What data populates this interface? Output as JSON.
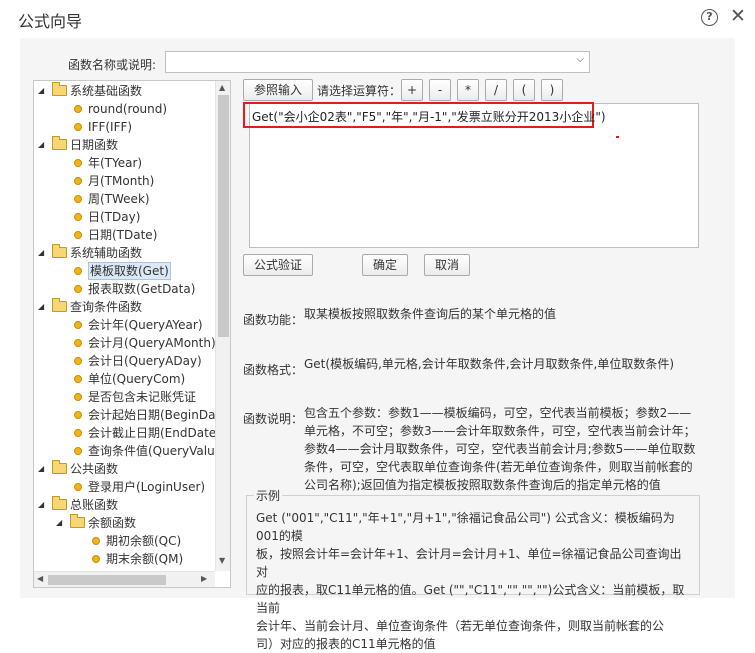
{
  "window": {
    "title": "公式向导"
  },
  "function_name": {
    "label": "函数名称或说明:",
    "value": ""
  },
  "tree": [
    {
      "level": 0,
      "type": "folder",
      "label": "系统基础函数",
      "expanded": true
    },
    {
      "level": 1,
      "type": "leaf",
      "label": "round(round)"
    },
    {
      "level": 1,
      "type": "leaf",
      "label": "IFF(IFF)"
    },
    {
      "level": 0,
      "type": "folder",
      "label": "日期函数",
      "expanded": true
    },
    {
      "level": 1,
      "type": "leaf",
      "label": "年(TYear)"
    },
    {
      "level": 1,
      "type": "leaf",
      "label": "月(TMonth)"
    },
    {
      "level": 1,
      "type": "leaf",
      "label": "周(TWeek)"
    },
    {
      "level": 1,
      "type": "leaf",
      "label": "日(TDay)"
    },
    {
      "level": 1,
      "type": "leaf",
      "label": "日期(TDate)"
    },
    {
      "level": 0,
      "type": "folder",
      "label": "系统辅助函数",
      "expanded": true
    },
    {
      "level": 1,
      "type": "leaf",
      "label": "模板取数(Get)",
      "selected": true
    },
    {
      "level": 1,
      "type": "leaf",
      "label": "报表取数(GetData)"
    },
    {
      "level": 0,
      "type": "folder",
      "label": "查询条件函数",
      "expanded": true
    },
    {
      "level": 1,
      "type": "leaf",
      "label": "会计年(QueryAYear)"
    },
    {
      "level": 1,
      "type": "leaf",
      "label": "会计月(QueryAMonth)"
    },
    {
      "level": 1,
      "type": "leaf",
      "label": "会计日(QueryADay)"
    },
    {
      "level": 1,
      "type": "leaf",
      "label": "单位(QueryCom)"
    },
    {
      "level": 1,
      "type": "leaf",
      "label": "是否包含未记账凭证"
    },
    {
      "level": 1,
      "type": "leaf",
      "label": "会计起始日期(BeginDate)"
    },
    {
      "level": 1,
      "type": "leaf",
      "label": "会计截止日期(EndDate)"
    },
    {
      "level": 1,
      "type": "leaf",
      "label": "查询条件值(QueryValue)"
    },
    {
      "level": 0,
      "type": "folder",
      "label": "公共函数",
      "expanded": true
    },
    {
      "level": 1,
      "type": "leaf",
      "label": "登录用户(LoginUser)"
    },
    {
      "level": 0,
      "type": "folder",
      "label": "总账函数",
      "expanded": true
    },
    {
      "level": 1,
      "type": "folder",
      "label": "余额函数",
      "expanded": true
    },
    {
      "level": 2,
      "type": "leaf",
      "label": "期初余额(QC)"
    },
    {
      "level": 2,
      "type": "leaf",
      "label": "期末余额(QM)"
    }
  ],
  "toolbar": {
    "ref_input": "参照输入",
    "operator_label": "请选择运算符：",
    "operators": [
      "+",
      "-",
      "*",
      "/",
      "(",
      ")"
    ]
  },
  "formula": {
    "value": "Get(\"会小企02表\",\"F5\",\"年\",\"月-1\",\"发票立账分开2013小企业\")"
  },
  "actions": {
    "verify": "公式验证",
    "ok": "确定",
    "cancel": "取消"
  },
  "info": {
    "function_label": "函数功能：",
    "function_text": "取某模板按照取数条件查询后的某个单元格的值",
    "format_label": "函数格式：",
    "format_text": "Get(模板编码,单元格,会计年取数条件,会计月取数条件,单位取数条件)",
    "desc_label": "函数说明：",
    "desc_lines": [
      "包含五个参数：参数1——模板编码，可空，空代表当前模板；参数2——",
      "单元格，不可空；参数3——会计年取数条件，可空，空代表当前会计年；",
      "参数4——会计月取数条件，可空，空代表当前会计月;参数5——单位取数",
      "条件，可空，空代表取单位查询条件(若无单位查询条件，则取当前帐套的",
      "公司名称);返回值为指定模板按照取数条件查询后的指定单元格的值"
    ]
  },
  "example": {
    "legend": "示例",
    "lines": [
      "Get (\"001\",\"C11\",\"年+1\",\"月+1\",\"徐福记食品公司\") 公式含义：模板编码为001的模",
      "板，按照会计年=会计年+1、会计月=会计月+1、单位=徐福记食品公司查询出对",
      "应的报表，取C11单元格的值。Get (\"\",\"C11\",\"\",\"\",\"\")公式含义：当前模板，取当前",
      "会计年、当前会计月、单位查询条件（若无单位查询条件，则取当前帐套的公",
      "司）对应的报表的C11单元格的值"
    ]
  }
}
